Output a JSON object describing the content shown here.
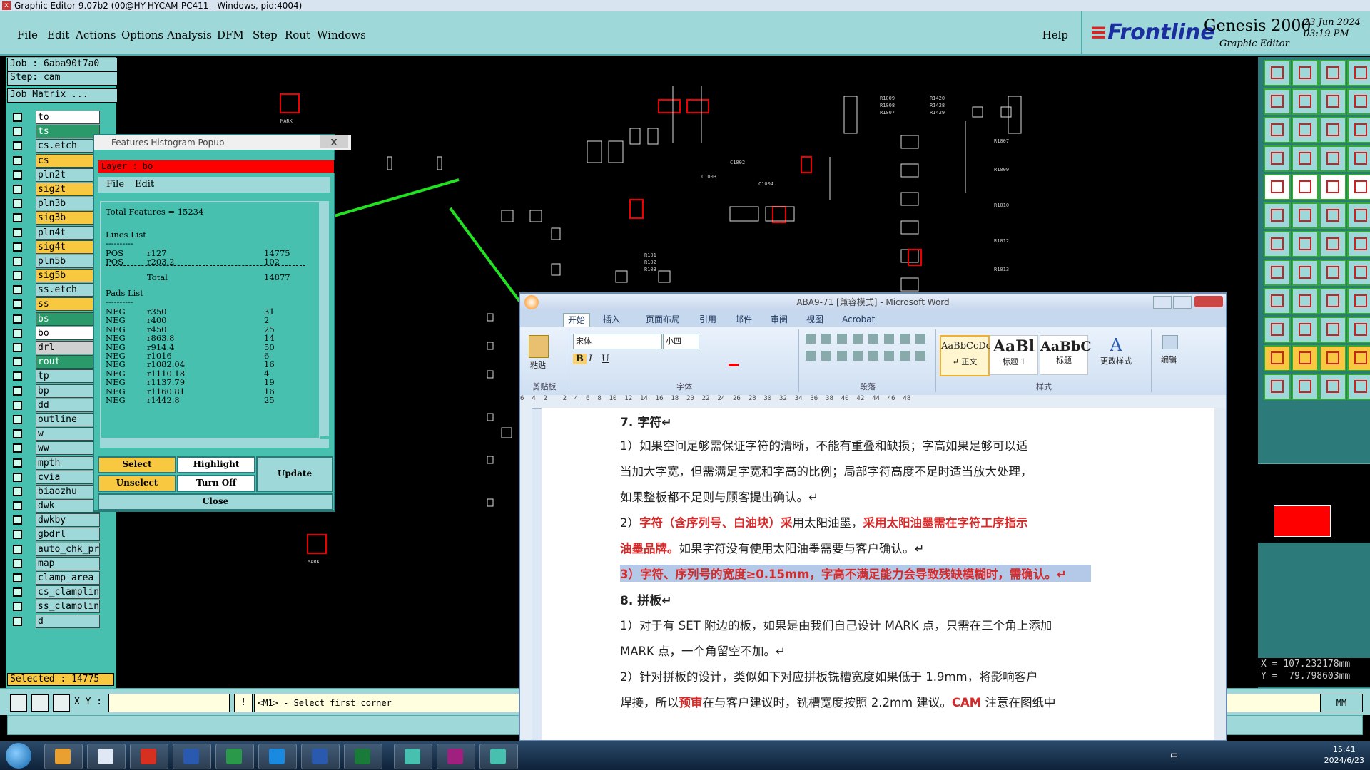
{
  "window": {
    "title": "Graphic Editor 9.07b2 (00@HY-HYCAM-PC411 - Windows, pid:4004)"
  },
  "menu": [
    "File",
    "Edit",
    "Actions",
    "Options",
    "Analysis",
    "DFM",
    "Step",
    "Rout",
    "Windows"
  ],
  "help": "Help",
  "brand": {
    "logo": "Frontline",
    "product": "Genesis 2000",
    "sub": "Graphic Editor",
    "date": "23 Jun 2024",
    "time": "03:19 PM"
  },
  "job": {
    "job": "Job : 6aba90t7a0",
    "step": "Step: cam",
    "matrix": "Job Matrix ..."
  },
  "layers": [
    {
      "name": "to",
      "style": "top"
    },
    {
      "name": "ts",
      "style": "green"
    },
    {
      "name": "cs.etch",
      "style": ""
    },
    {
      "name": "cs",
      "style": "selL"
    },
    {
      "name": "pln2t",
      "style": ""
    },
    {
      "name": "sig2t",
      "style": "selL"
    },
    {
      "name": "pln3b",
      "style": ""
    },
    {
      "name": "sig3b",
      "style": "selL"
    },
    {
      "name": "pln4t",
      "style": ""
    },
    {
      "name": "sig4t",
      "style": "selL"
    },
    {
      "name": "pln5b",
      "style": ""
    },
    {
      "name": "sig5b",
      "style": "selL"
    },
    {
      "name": "ss.etch",
      "style": ""
    },
    {
      "name": "ss",
      "style": "selL"
    },
    {
      "name": "bs",
      "style": "green"
    },
    {
      "name": "bo",
      "style": "active"
    },
    {
      "name": "drl",
      "style": "gray"
    },
    {
      "name": "rout",
      "style": "green"
    },
    {
      "name": "tp",
      "style": ""
    },
    {
      "name": "bp",
      "style": ""
    },
    {
      "name": "dd",
      "style": ""
    },
    {
      "name": "outline",
      "style": ""
    },
    {
      "name": "w",
      "style": ""
    },
    {
      "name": "ww",
      "style": ""
    },
    {
      "name": "mpth",
      "style": ""
    },
    {
      "name": "cvia",
      "style": ""
    },
    {
      "name": "biaozhu",
      "style": ""
    },
    {
      "name": "dwk",
      "style": ""
    },
    {
      "name": "dwkby",
      "style": ""
    },
    {
      "name": "gbdrl",
      "style": ""
    },
    {
      "name": "auto_chk_pr",
      "style": ""
    },
    {
      "name": "map",
      "style": ""
    },
    {
      "name": "clamp_area",
      "style": ""
    },
    {
      "name": "cs_clamplin",
      "style": ""
    },
    {
      "name": "ss_clamplin",
      "style": ""
    },
    {
      "name": "d",
      "style": ""
    }
  ],
  "selected": "Selected : 14775",
  "coords": {
    "x": "X = 107.232178mm",
    "y": "Y =  79.798603mm"
  },
  "bottom": {
    "xy_label": "X Y :",
    "excl": "!",
    "prompt": "<M1> - Select first corner",
    "units": "MM"
  },
  "histogram": {
    "title": "Features Histogram Popup",
    "close_x": "X",
    "layer": "Layer :  bo",
    "menu": [
      "File",
      "Edit"
    ],
    "total": "Total Features = 15234",
    "lines_title": "Lines List",
    "sep": "----------",
    "lines": [
      {
        "pol": "POS",
        "sym": "r127",
        "count": "14775"
      },
      {
        "pol": "POS",
        "sym": "r203.2",
        "count": "102"
      }
    ],
    "lines_total_label": "Total",
    "lines_total": "14877",
    "pads_title": "Pads List",
    "pads": [
      {
        "pol": "NEG",
        "sym": "r350",
        "count": "31"
      },
      {
        "pol": "NEG",
        "sym": "r400",
        "count": "2"
      },
      {
        "pol": "NEG",
        "sym": "r450",
        "count": "25"
      },
      {
        "pol": "NEG",
        "sym": "r863.8",
        "count": "14"
      },
      {
        "pol": "NEG",
        "sym": "r914.4",
        "count": "50"
      },
      {
        "pol": "NEG",
        "sym": "r1016",
        "count": "6"
      },
      {
        "pol": "NEG",
        "sym": "r1082.04",
        "count": "16"
      },
      {
        "pol": "NEG",
        "sym": "r1110.18",
        "count": "4"
      },
      {
        "pol": "NEG",
        "sym": "r1137.79",
        "count": "19"
      },
      {
        "pol": "NEG",
        "sym": "r1160.81",
        "count": "16"
      },
      {
        "pol": "NEG",
        "sym": "r1442.8",
        "count": "25"
      }
    ],
    "buttons": {
      "select": "Select",
      "highlight": "Highlight",
      "unselect": "Unselect",
      "turnoff": "Turn Off",
      "update": "Update",
      "close": "Close"
    }
  },
  "word": {
    "title": "ABA9-71 [兼容模式] - Microsoft Word",
    "tabs": [
      "开始",
      "插入",
      "页面布局",
      "引用",
      "邮件",
      "审阅",
      "视图",
      "Acrobat"
    ],
    "font": "宋体",
    "size": "小四",
    "groups": {
      "clipboard": "剪贴板",
      "paste": "粘贴",
      "font": "字体",
      "para": "段落",
      "styles": "样式",
      "edit": "编辑",
      "change": "更改样式"
    },
    "styles": [
      {
        "sample": "AaBbCcDc",
        "name": "↵ 正文"
      },
      {
        "sample": "AaBl",
        "name": "标题 1"
      },
      {
        "sample": "AaBbC",
        "name": "标题"
      }
    ],
    "ruler": "6  4  2    2  4  6  8  10  12  14  16  18  20  22  24  26  28  30  32  34  36  38  40  42  44  46  48",
    "paras": [
      {
        "t": "7. 字符↵"
      },
      {
        "t": "1）如果空间足够需保证字符的清晰，不能有重叠和缺损；字高如果足够可以适"
      },
      {
        "t": "当加大字宽，但需满足字宽和字高的比例；局部字符高度不足时适当放大处理，"
      },
      {
        "t": "如果整板都不足则与顾客提出确认。↵"
      },
      {
        "a": "2）",
        "b": "字符（含序列号、白油块）采",
        "c": "用太阳油墨，",
        "d": "采用太阳油墨需在字符工序指示"
      },
      {
        "a": "",
        "b": "油墨品牌。",
        "c": "如果字符没有使用太阳油墨需要与客户确认。↵",
        "d": ""
      },
      {
        "t": "3）字符、序列号的宽度≥0.15mm，字高不满足能力会导致残缺模糊时，需确认。↵"
      },
      {
        "t": "8. 拼板↵"
      },
      {
        "t": "1）对于有 SET 附边的板，如果是由我们自己设计 MARK 点，只需在三个角上添加"
      },
      {
        "t": "MARK 点，一个角留空不加。↵"
      },
      {
        "t": "2）针对拼板的设计，类似如下对应拼板铣槽宽度如果低于 1.9mm，将影响客户"
      },
      {
        "a": "焊接，所以",
        "b": "预审",
        "c": "在与客户建议时，铣槽宽度按照 2.2mm 建议。",
        "d": "CAM",
        "e": " 注意在图纸中"
      }
    ]
  },
  "clock": {
    "time": "15:41",
    "date": "2024/6/23"
  },
  "tray": "中"
}
